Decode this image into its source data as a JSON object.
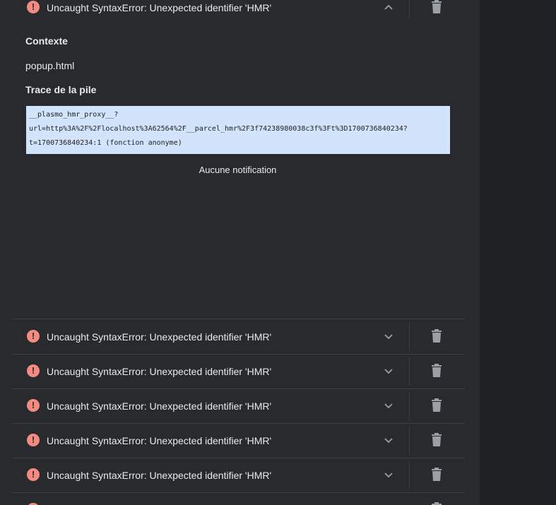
{
  "expanded_error": {
    "message": "Uncaught SyntaxError: Unexpected identifier 'HMR'",
    "context_heading": "Contexte",
    "context_value": "popup.html",
    "stack_heading": "Trace de la pile",
    "stack_lines": [
      "__plasmo_hmr_proxy__?",
      "url=http%3A%2F%2Flocalhost%3A62564%2F__parcel_hmr%2F3f74238980038c3f%3Ft%3D1700736840234?",
      "t=1700736840234:1 (fonction anonyme)"
    ],
    "notification": "Aucune notification"
  },
  "errors": [
    {
      "message": "Uncaught SyntaxError: Unexpected identifier 'HMR'"
    },
    {
      "message": "Uncaught SyntaxError: Unexpected identifier 'HMR'"
    },
    {
      "message": "Uncaught SyntaxError: Unexpected identifier 'HMR'"
    },
    {
      "message": "Uncaught SyntaxError: Unexpected identifier 'HMR'"
    },
    {
      "message": "Uncaught SyntaxError: Unexpected identifier 'HMR'"
    }
  ],
  "icons": {
    "error": "error-circle-icon",
    "expand": "chevron-down-icon",
    "collapse": "chevron-up-icon",
    "delete": "trash-icon"
  },
  "colors": {
    "panel": "#292a2d",
    "background": "#202124",
    "error_icon": "#f28b82",
    "stack_highlight": "#d2e3fc"
  }
}
